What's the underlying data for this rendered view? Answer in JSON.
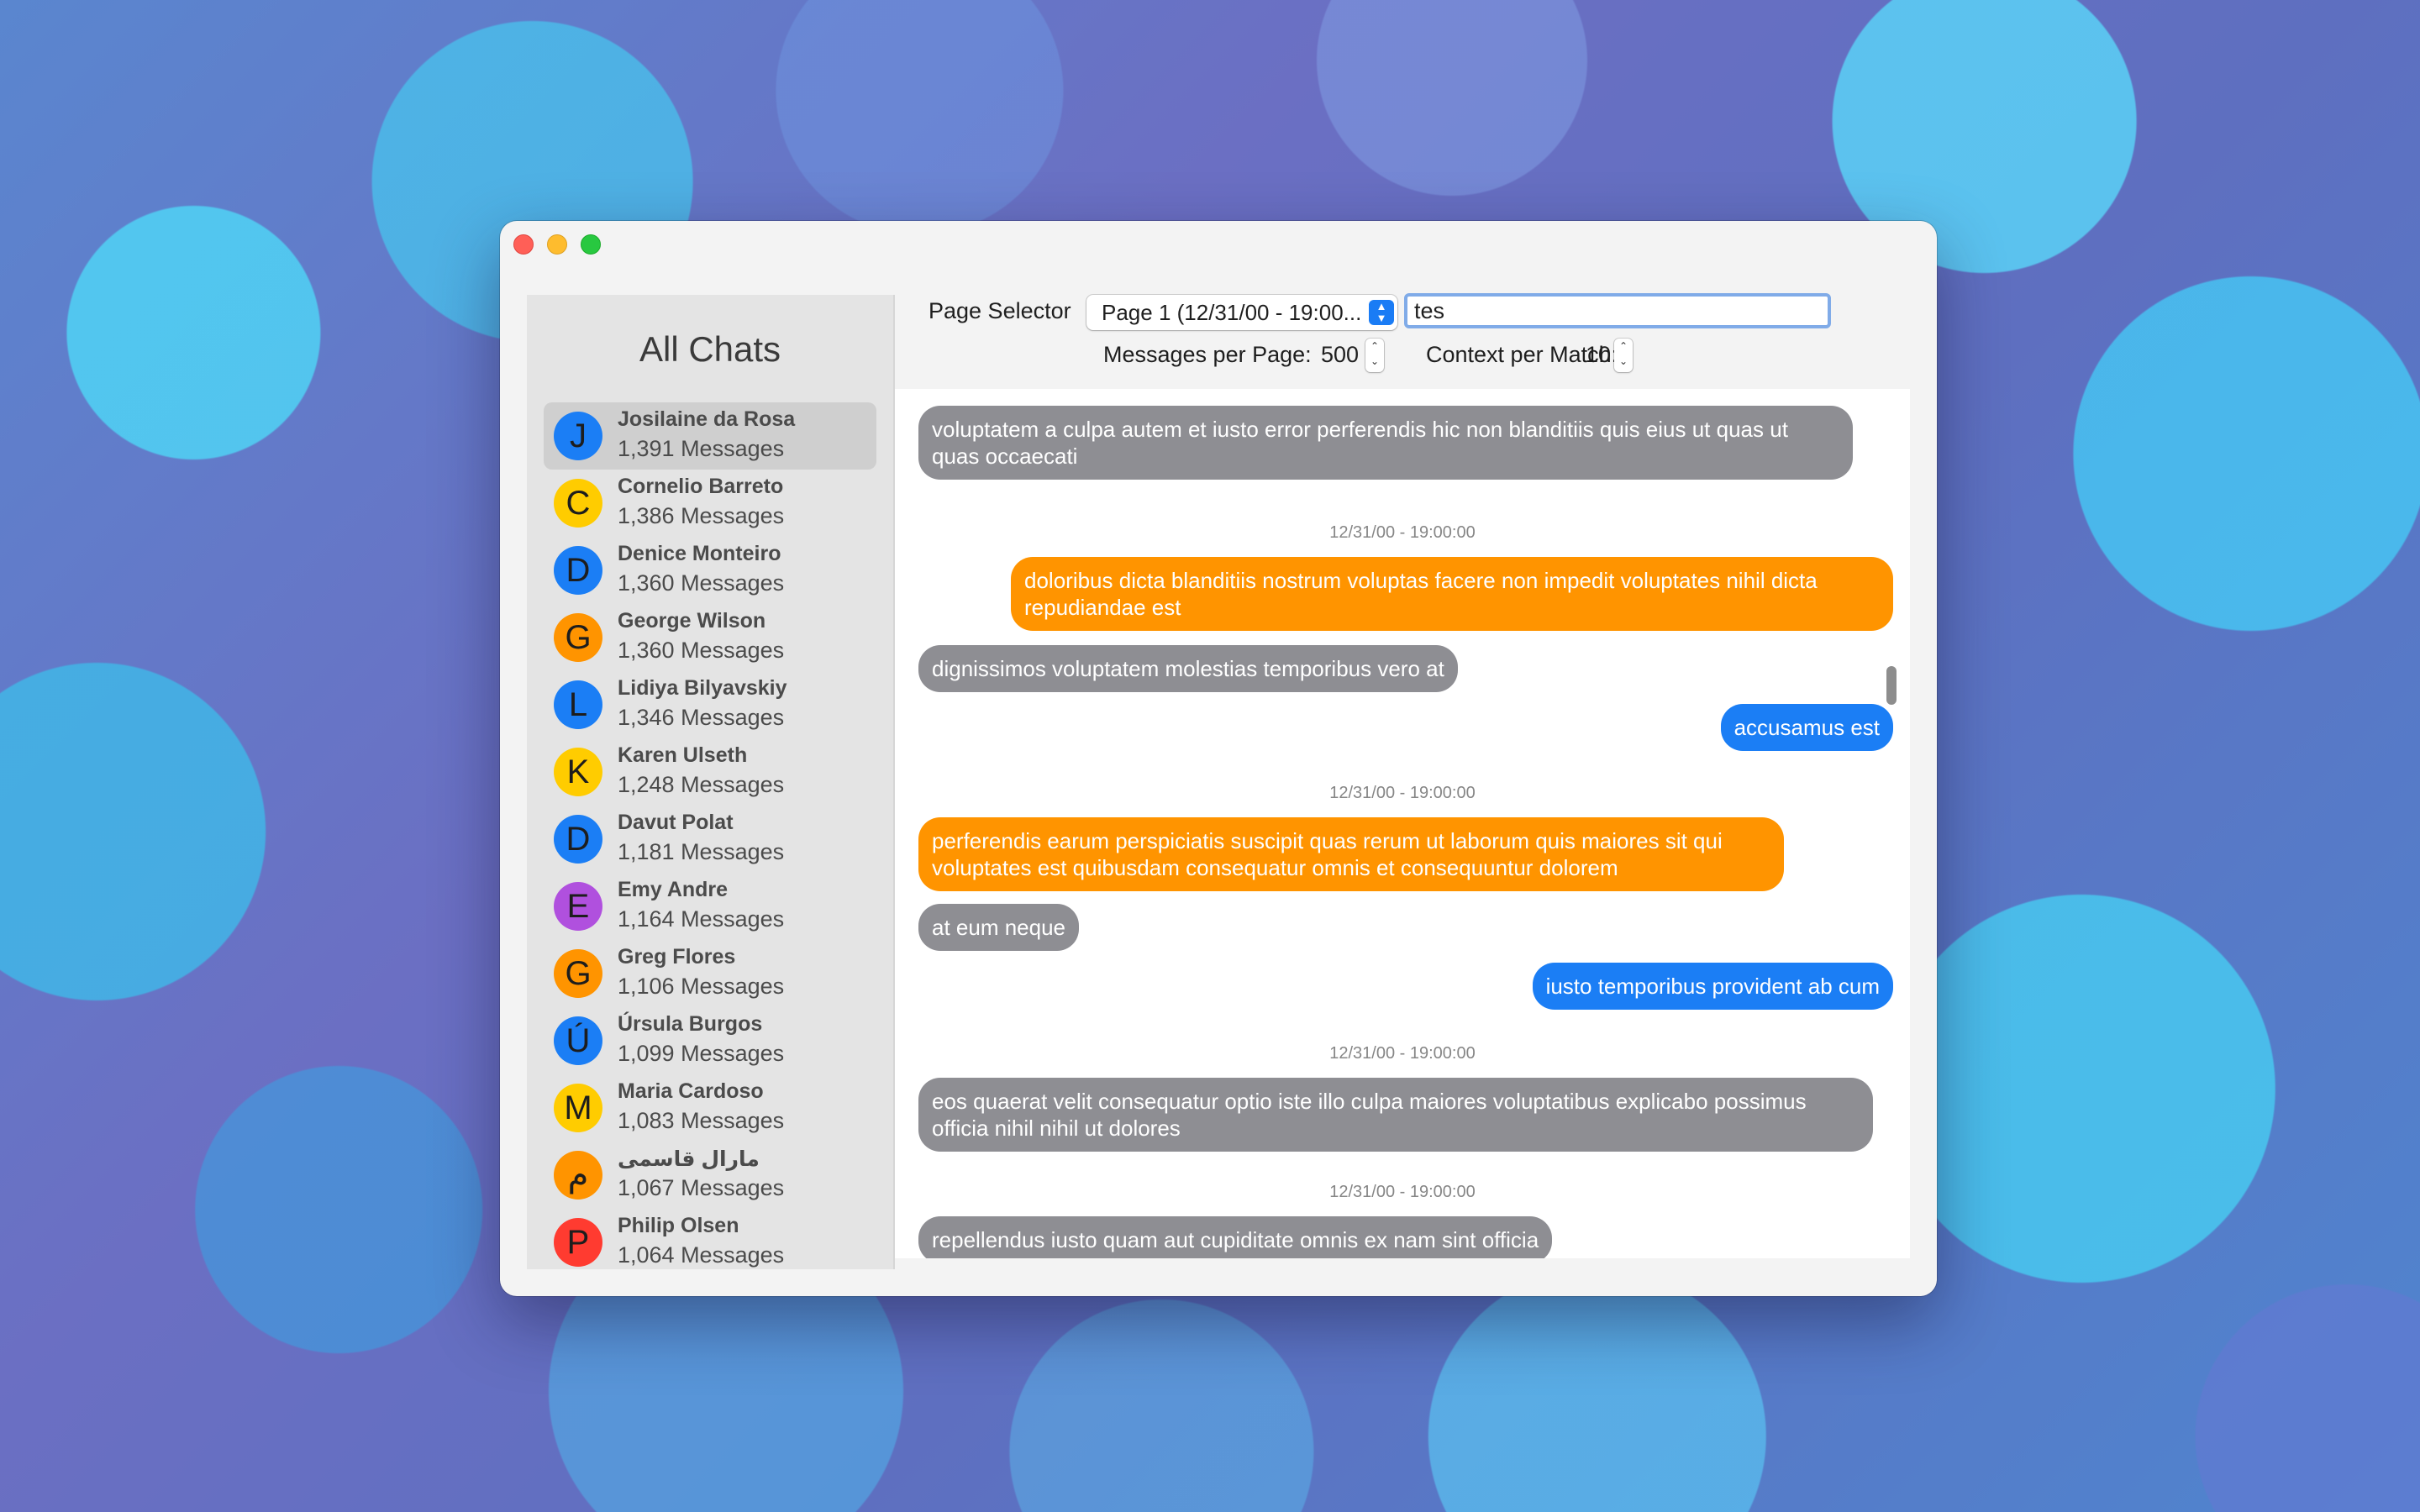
{
  "window": {
    "traffic_lights": [
      "close",
      "minimize",
      "maximize"
    ]
  },
  "sidebar": {
    "title": "All Chats",
    "chats": [
      {
        "initial": "J",
        "name": "Josilaine da Rosa",
        "count": "1,391 Messages",
        "color": "#1b7ef5",
        "selected": true
      },
      {
        "initial": "C",
        "name": "Cornelio Barreto",
        "count": "1,386 Messages",
        "color": "#ffcc00"
      },
      {
        "initial": "D",
        "name": "Denice Monteiro",
        "count": "1,360 Messages",
        "color": "#1b7ef5"
      },
      {
        "initial": "G",
        "name": "George Wilson",
        "count": "1,360 Messages",
        "color": "#ff9400"
      },
      {
        "initial": "L",
        "name": "Lidiya Bilyavskiy",
        "count": "1,346 Messages",
        "color": "#1b7ef5"
      },
      {
        "initial": "K",
        "name": "Karen Ulseth",
        "count": "1,248 Messages",
        "color": "#ffcc00"
      },
      {
        "initial": "D",
        "name": "Davut Polat",
        "count": "1,181 Messages",
        "color": "#1b7ef5"
      },
      {
        "initial": "E",
        "name": "Emy Andre",
        "count": "1,164 Messages",
        "color": "#b050de"
      },
      {
        "initial": "G",
        "name": "Greg Flores",
        "count": "1,106 Messages",
        "color": "#ff9400"
      },
      {
        "initial": "Ú",
        "name": "Úrsula Burgos",
        "count": "1,099 Messages",
        "color": "#1b7ef5"
      },
      {
        "initial": "M",
        "name": "Maria Cardoso",
        "count": "1,083 Messages",
        "color": "#ffcc00"
      },
      {
        "initial": "م",
        "name": "مارال قاسمی",
        "count": "1,067 Messages",
        "color": "#ff9400"
      },
      {
        "initial": "P",
        "name": "Philip Olsen",
        "count": "1,064 Messages",
        "color": "#ff3b30"
      }
    ]
  },
  "toolbar": {
    "page_selector_label": "Page Selector",
    "page_selector_value": "Page 1 (12/31/00 - 19:00...",
    "search_value": "tes",
    "messages_per_page_label": "Messages per Page:",
    "messages_per_page_value": "500",
    "context_per_match_label": "Context per Match:",
    "context_per_match_value": "10"
  },
  "messages": [
    {
      "type": "bubble",
      "side": "left",
      "style": "gray",
      "text": "voluptatem a culpa autem et iusto error perferendis hic non blanditiis quis eius ut quas ut quas occaecati"
    },
    {
      "type": "timestamp",
      "text": "12/31/00 - 19:00:00"
    },
    {
      "type": "bubble",
      "side": "right",
      "style": "orange",
      "text": "doloribus dicta blanditiis nostrum voluptas facere non impedit voluptates nihil dicta repudiandae est"
    },
    {
      "type": "bubble",
      "side": "left",
      "style": "gray",
      "text": "dignissimos voluptatem molestias temporibus vero at"
    },
    {
      "type": "bubble",
      "side": "right",
      "style": "blue",
      "text": "accusamus est"
    },
    {
      "type": "timestamp",
      "text": "12/31/00 - 19:00:00"
    },
    {
      "type": "bubble",
      "side": "left",
      "style": "orange",
      "text": "perferendis earum perspiciatis suscipit quas rerum ut laborum quis maiores sit qui voluptates est quibusdam consequatur omnis et consequuntur dolorem"
    },
    {
      "type": "bubble",
      "side": "left",
      "style": "gray",
      "text": "at eum neque"
    },
    {
      "type": "bubble",
      "side": "right",
      "style": "blue",
      "text": "iusto temporibus provident ab cum"
    },
    {
      "type": "timestamp",
      "text": "12/31/00 - 19:00:00"
    },
    {
      "type": "bubble",
      "side": "left",
      "style": "gray",
      "text": "eos quaerat velit consequatur optio iste illo culpa maiores voluptatibus explicabo possimus officia nihil nihil ut dolores"
    },
    {
      "type": "timestamp",
      "text": "12/31/00 - 19:00:00"
    },
    {
      "type": "bubble",
      "side": "left",
      "style": "gray",
      "text": "repellendus iusto quam aut cupiditate omnis ex nam sint officia"
    }
  ]
}
